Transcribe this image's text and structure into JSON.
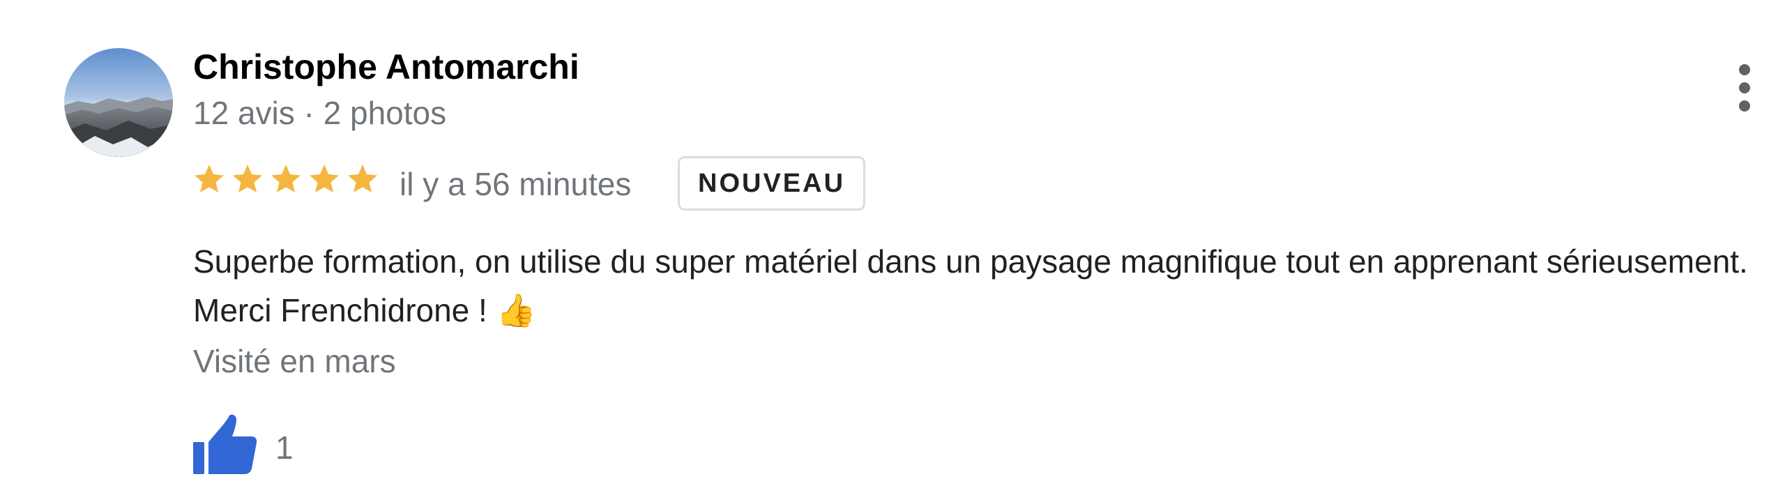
{
  "review": {
    "author": {
      "name": "Christophe Antomarchi",
      "meta": "12 avis · 2 photos"
    },
    "rating": {
      "stars": 5,
      "max": 5,
      "star_color": "#f4b63f"
    },
    "time_ago": "il y a 56 minutes",
    "badge": "NOUVEAU",
    "text": "Superbe formation, on utilise du super matériel dans un paysage magnifique tout en apprenant sérieusement. Merci Frenchidrone ! 👍",
    "visited": "Visité en mars",
    "likes": {
      "count": "1",
      "icon": "thumbs-up-icon",
      "color": "#3367d6"
    },
    "menu_icon": "more-vert-icon"
  }
}
